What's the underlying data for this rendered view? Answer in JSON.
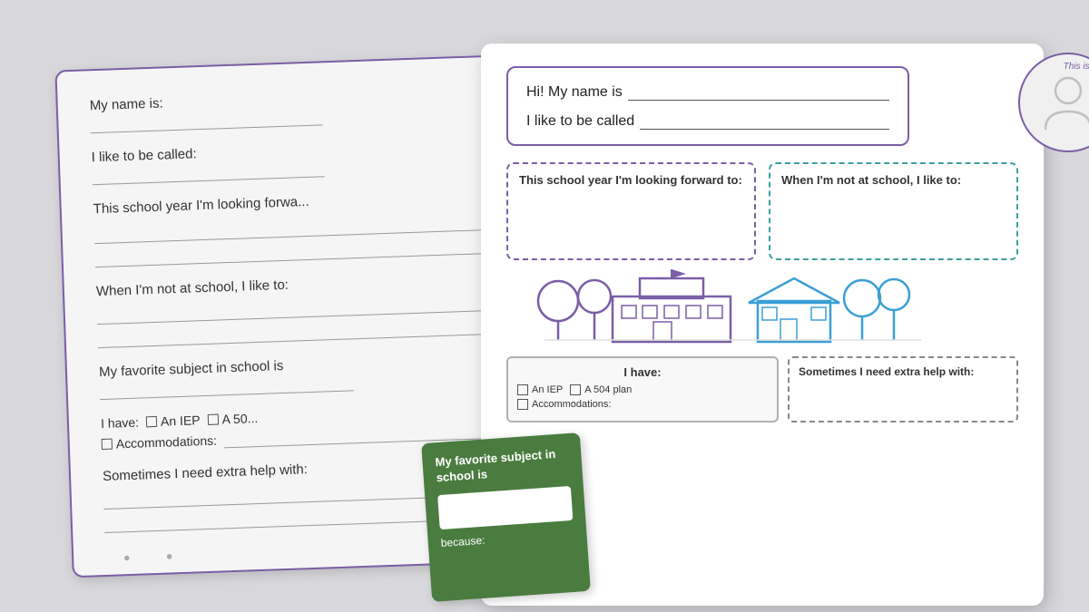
{
  "back_paper": {
    "line1_label": "My name is:",
    "line2_label": "I like to be called:",
    "line3_label": "This school year I'm looking forwa...",
    "line4_label": "When I'm not at school, I like to:",
    "line5_label": "My favorite subject in school is",
    "line6_label": "I have:",
    "line6_iep": "An IEP",
    "line6_504": "A 50...",
    "line6_acc": "Accommodations:",
    "line7_label": "Sometimes I need extra help with:"
  },
  "front_paper": {
    "name_row1": "Hi! My name is",
    "name_row2": "I like to be called",
    "photo_label": "This is me:",
    "box1_label": "This school year I'm looking forward to:",
    "box2_label": "When I'm not at school, I like to:",
    "i_have_title": "I have:",
    "i_have_iep": "An IEP",
    "i_have_504": "A 504 plan",
    "i_have_acc": "Accommodations:",
    "sometimes_title": "Sometimes I need extra help with:"
  },
  "green_card": {
    "title": "My favorite subject in school is",
    "because_label": "because:"
  }
}
